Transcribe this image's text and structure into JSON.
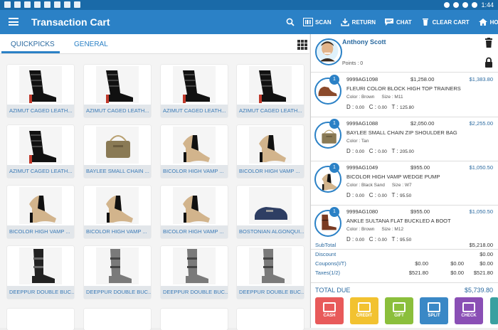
{
  "status_bar": {
    "time": "1:44"
  },
  "app_bar": {
    "title": "Transaction Cart",
    "actions": [
      {
        "label": "SCAN",
        "icon": "barcode-icon"
      },
      {
        "label": "RETURN",
        "icon": "download-icon"
      },
      {
        "label": "CHAT",
        "icon": "chat-icon"
      },
      {
        "label": "CLEAR CART",
        "icon": "clear-cart-icon"
      },
      {
        "label": "HOME",
        "icon": "home-icon"
      }
    ]
  },
  "tabs": [
    {
      "label": "QUICKPICKS",
      "active": true
    },
    {
      "label": "GENERAL",
      "active": false
    }
  ],
  "products": [
    {
      "label": "AZIMUT CAGED LEATH...",
      "kind": "bootie"
    },
    {
      "label": "AZIMUT CAGED LEATH...",
      "kind": "bootie"
    },
    {
      "label": "AZIMUT CAGED LEATH...",
      "kind": "bootie"
    },
    {
      "label": "AZIMUT CAGED LEATH...",
      "kind": "bootie"
    },
    {
      "label": "AZIMUT CAGED LEATH...",
      "kind": "bootie"
    },
    {
      "label": "BAYLEE SMALL CHAIN ...",
      "kind": "bag"
    },
    {
      "label": "BICOLOR HIGH VAMP ...",
      "kind": "pump"
    },
    {
      "label": "BICOLOR HIGH VAMP ...",
      "kind": "pump"
    },
    {
      "label": "BICOLOR HIGH VAMP ...",
      "kind": "pump"
    },
    {
      "label": "BICOLOR HIGH VAMP ...",
      "kind": "pump"
    },
    {
      "label": "BICOLOR HIGH VAMP ...",
      "kind": "pump"
    },
    {
      "label": "BOSTONIAN ALGONQUI...",
      "kind": "loafer"
    },
    {
      "label": "DEEPPUR DOUBLE BUC...",
      "kind": "boot-black"
    },
    {
      "label": "DEEPPUR DOUBLE BUC...",
      "kind": "boot-gray"
    },
    {
      "label": "DEEPPUR DOUBLE BUC...",
      "kind": "boot-gray"
    },
    {
      "label": "DEEPPUR DOUBLE BUC...",
      "kind": "boot-gray"
    }
  ],
  "customer": {
    "name": "Anthony Scott",
    "points": "Points : 0"
  },
  "cart_items": [
    {
      "qty": "1",
      "sku": "9999AG1098",
      "price": "$1,258.00",
      "total": "$1,383.80",
      "name": "FLEURI COLOR BLOCK HIGH TOP TRAINERS",
      "color": "Color : Brown",
      "size": "Size : M11",
      "d": "0.00",
      "c": "0.00",
      "t": "125.80",
      "thumb": "sneaker"
    },
    {
      "qty": "1",
      "sku": "9999AG1088",
      "price": "$2,050.00",
      "total": "$2,255.00",
      "name": "BAYLEE SMALL CHAIN ZIP SHOULDER BAG",
      "color": "Color : Tan",
      "size": "",
      "d": "0.00",
      "c": "0.00",
      "t": "205.00",
      "thumb": "bag"
    },
    {
      "qty": "1",
      "sku": "9999AG1049",
      "price": "$955.00",
      "total": "$1,050.50",
      "name": "BICOLOR HIGH VAMP WEDGE PUMP",
      "color": "Color : Black Sand",
      "size": "Size : W7",
      "d": "0.00",
      "c": "0.00",
      "t": "95.50",
      "thumb": "pump"
    },
    {
      "qty": "1",
      "sku": "9999AG1080",
      "price": "$955.00",
      "total": "$1,050.50",
      "name": "ANKLE SULTANA FLAT BUCKLED A BOOT",
      "color": "Color : Brown",
      "size": "Size : M12",
      "d": "0.00",
      "c": "0.00",
      "t": "95.50",
      "thumb": "boot-brown"
    }
  ],
  "summary": {
    "subtotal": {
      "label": "SubTotal",
      "value": "$5,218.00"
    },
    "discount": {
      "label": "Discount",
      "value": "$0.00"
    },
    "coupons": {
      "label": "Coupons(I/T)",
      "c1": "$0.00",
      "c2": "$0.00",
      "value": "$0.00"
    },
    "taxes": {
      "label": "Taxes(1/2)",
      "c1": "$521.80",
      "c2": "$0.00",
      "value": "$521.80"
    },
    "total_due": {
      "label": "TOTAL DUE",
      "value": "$5,739.80"
    }
  },
  "payments": [
    {
      "label": "CASH",
      "color": "#e85a5a"
    },
    {
      "label": "CREDIT",
      "color": "#f2c230"
    },
    {
      "label": "GIFT",
      "color": "#8bbf3c"
    },
    {
      "label": "SPLIT",
      "color": "#3a88c6"
    },
    {
      "label": "CHECK",
      "color": "#8a4fb5"
    }
  ],
  "colors": {
    "app_bar": "#2b81c6",
    "status_bar": "#1a6aa8",
    "accent": "#2b6aa0"
  }
}
